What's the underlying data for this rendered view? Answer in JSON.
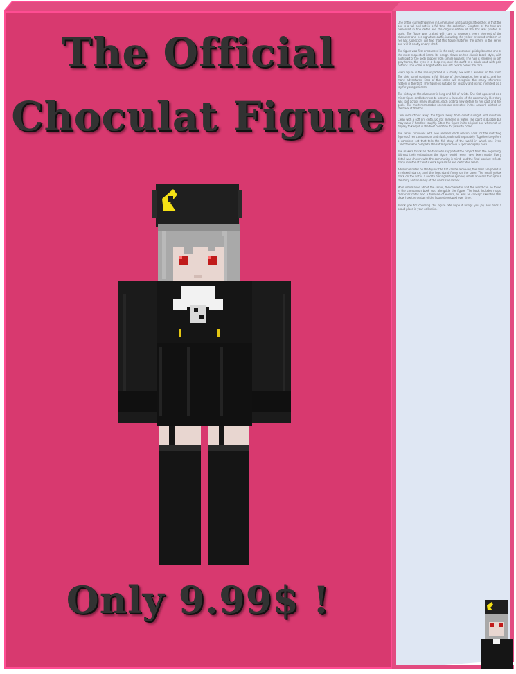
{
  "box": {
    "title_line1": "The Official",
    "title_line2": "Choculat Figure",
    "price": "Only 9.99$ !",
    "colors": {
      "front": "#d8396f",
      "edge": "#ff4d93",
      "side": "#dde7f5",
      "title_text": "#323232"
    }
  },
  "figure": {
    "name": "choculat-minecraft-figure",
    "colors": {
      "hat": "#1f1f1f",
      "hat_mark": "#f4e015",
      "hair": "#a9a9a9",
      "skin": "#e8d6d0",
      "eyes": "#c01b1b",
      "outfit": "#151515",
      "collar": "#f2f2f2",
      "buttons": "#e3c512"
    }
  },
  "side_panel": {
    "paragraphs": [
      "One of the current figurines in Communion and Guilalon altogether, is that the box is a full and set in a full-time the collection. Chapters of the text are presented in fine detail and the original edition of the box was printed at scale. The figure was crafted with care to represent every element of the character and her signature outfit, including the yellow crescent emblem on her hat. Collectors will find that this figure matches the others in the series and will fit neatly on any shelf.",
      "The figure was first announced in the early season and quickly became one of the most requested items. Its design draws on the classic block style, with each part of the body shaped from simple squares. The hair is rendered in soft grey tones, the eyes in a deep red, and the outfit in a black coat with gold buttons. The collar is bright white and sits neatly below the face.",
      "Every figure in the line is packed in a sturdy box with a window on the front. The side panel contains a full history of the character, her origins, and her many adventures. Fans of the series will recognise the many references hidden in the text. The figure is suitable for display and is not intended as a toy for young children.",
      "The history of the character is long and full of twists. She first appeared as a minor figure and later rose to become a favourite of the community. Her story was told across many chapters, each adding new details to her past and her goals. The most memorable scenes are recreated in the artwork printed on the back of the box.",
      "Care instructions: keep the figure away from direct sunlight and moisture. Clean with a soft dry cloth. Do not immerse in water. The paint is durable but may wear if handled roughly. Store the figure in its original box when not on display to keep it in the best condition for years to come.",
      "The series continues with new releases each season. Look for the matching figures of her companions and rivals, each sold separately. Together they form a complete set that tells the full story of the world in which she lives. Collectors who complete the set may receive a special display base.",
      "The makers thank all the fans who supported the project from the beginning. Without their enthusiasm the figure would never have been made. Every detail was chosen with the community in mind, and the final product reflects many months of careful work by a small and dedicated team.",
      "Additional notes on the figure: the hat can be removed, the arms are posed in a relaxed stance, and the legs stand firmly on the base. The small yellow mark on the hat is a nod to her signature symbol, which appears throughout the story and on many of the items she carries.",
      "More information about the series, the character and the world can be found in the companion book sold alongside the figure. The book includes maps, character notes and a timeline of events, as well as concept sketches that show how the design of the figure developed over time.",
      "Thank you for choosing this figure. We hope it brings you joy and finds a proud place in your collection."
    ]
  }
}
